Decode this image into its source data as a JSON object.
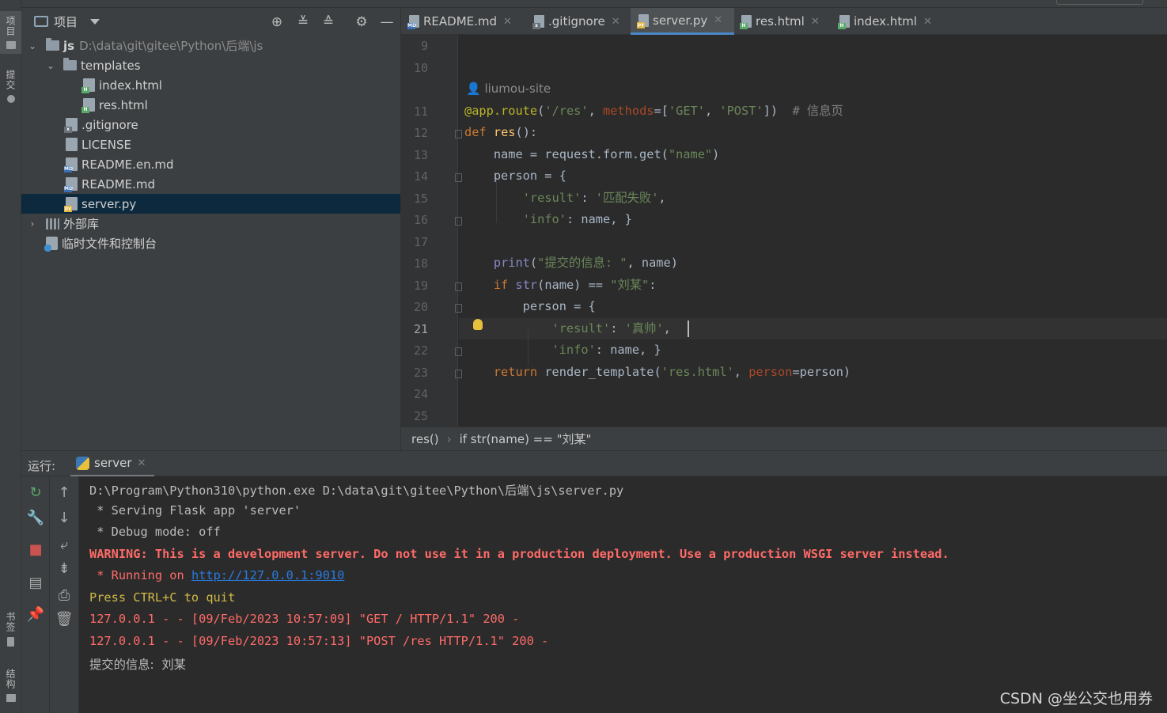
{
  "left_strip": {
    "project_label": "项目",
    "commit_label": "提交",
    "bookmarks_label": "书签",
    "structure_label": "结构"
  },
  "project": {
    "title": "项目",
    "tree": [
      {
        "name": "js",
        "path": "D:\\data\\git\\gitee\\Python\\后端\\js"
      },
      {
        "name": "templates"
      },
      {
        "name": "index.html"
      },
      {
        "name": "res.html"
      },
      {
        "name": ".gitignore"
      },
      {
        "name": "LICENSE"
      },
      {
        "name": "README.en.md"
      },
      {
        "name": "README.md"
      },
      {
        "name": "server.py"
      },
      {
        "name": "外部库"
      },
      {
        "name": "临时文件和控制台"
      }
    ]
  },
  "editor_tabs": [
    {
      "label": "README.md",
      "badge": "MD"
    },
    {
      "label": ".gitignore",
      "badge": "x"
    },
    {
      "label": "server.py",
      "badge": "py"
    },
    {
      "label": "res.html",
      "badge": "H"
    },
    {
      "label": "index.html",
      "badge": "H"
    }
  ],
  "editor": {
    "author_hint": "liumou-site",
    "line_numbers": [
      "9",
      "10",
      "11",
      "12",
      "13",
      "14",
      "15",
      "16",
      "17",
      "18",
      "19",
      "20",
      "21",
      "22",
      "23",
      "24",
      "25"
    ],
    "current_line": "21"
  },
  "breadcrumb": {
    "function": "res()",
    "condition": "if str(name) == \"刘某\""
  },
  "run": {
    "label": "运行:",
    "tab": "server"
  },
  "console": [
    {
      "text": "D:\\Program\\Python310\\python.exe D:\\data\\git\\gitee\\Python\\后端\\js\\server.py",
      "kind": "plain"
    },
    {
      "text": " * Serving Flask app 'server'",
      "kind": "plain"
    },
    {
      "text": " * Debug mode: off",
      "kind": "plain"
    },
    {
      "text": "WARNING: This is a development server. Do not use it in a production deployment. Use a production WSGI server instead.",
      "kind": "warn"
    },
    {
      "text": " * Running on ",
      "kind": "err",
      "link": "http://127.0.0.1:9010"
    },
    {
      "text": "Press CTRL+C to quit",
      "kind": "yellow"
    },
    {
      "text": "127.0.0.1 - - [09/Feb/2023 10:57:09] \"GET / HTTP/1.1\" 200 -",
      "kind": "err"
    },
    {
      "text": "127.0.0.1 - - [09/Feb/2023 10:57:13] \"POST /res HTTP/1.1\" 200 -",
      "kind": "err"
    },
    {
      "text": "提交的信息:  刘某",
      "kind": "plain"
    }
  ],
  "watermark": "CSDN @坐公交也用券",
  "colors": {
    "background": "#2b2b2b",
    "panel": "#3c3f41",
    "selection": "#0d293e",
    "accent": "#4a88c7",
    "keyword": "#cc7832",
    "string": "#6a8759",
    "decorator": "#bbb529",
    "warning": "#ff6b68"
  }
}
